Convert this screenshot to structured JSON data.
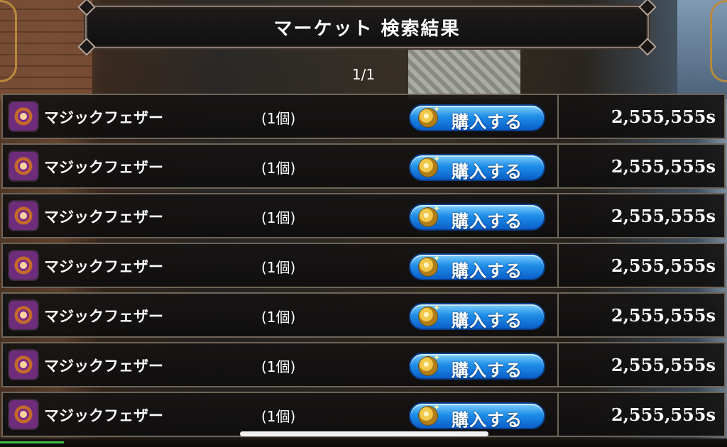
{
  "header": {
    "title": "マーケット 検索結果"
  },
  "pager": {
    "text": "1/1"
  },
  "listings": [
    {
      "name": "マジックフェザー",
      "qty": "(1個)",
      "buy_label": "購入する",
      "price": "2,555,555s"
    },
    {
      "name": "マジックフェザー",
      "qty": "(1個)",
      "buy_label": "購入する",
      "price": "2,555,555s"
    },
    {
      "name": "マジックフェザー",
      "qty": "(1個)",
      "buy_label": "購入する",
      "price": "2,555,555s"
    },
    {
      "name": "マジックフェザー",
      "qty": "(1個)",
      "buy_label": "購入する",
      "price": "2,555,555s"
    },
    {
      "name": "マジックフェザー",
      "qty": "(1個)",
      "buy_label": "購入する",
      "price": "2,555,555s"
    },
    {
      "name": "マジックフェザー",
      "qty": "(1個)",
      "buy_label": "購入する",
      "price": "2,555,555s"
    },
    {
      "name": "マジックフェザー",
      "qty": "(1個)",
      "buy_label": "購入する",
      "price": "2,555,555s"
    }
  ],
  "icons": {
    "item": "magic-feather-icon",
    "buy": "coin-icon"
  },
  "colors": {
    "buy_button": "#1f8ee8",
    "row_border": "#6e6459",
    "header_bg": "#111111"
  }
}
